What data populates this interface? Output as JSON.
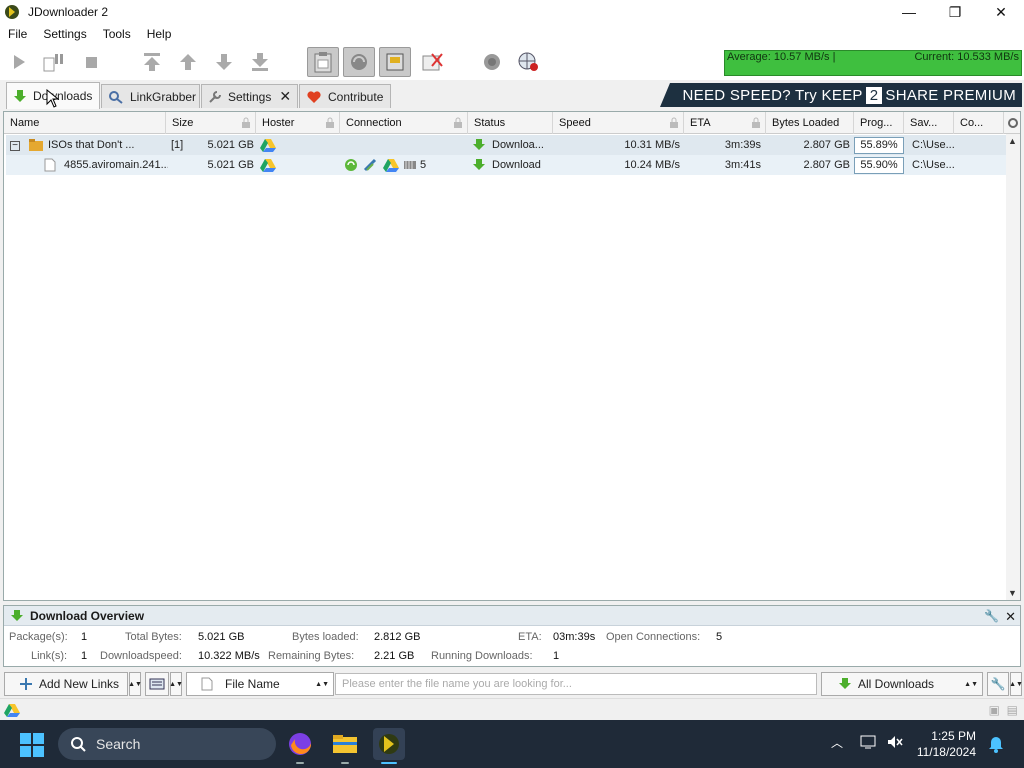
{
  "window": {
    "title": "JDownloader 2",
    "controls": [
      "minimize",
      "maximize",
      "close"
    ]
  },
  "menu": [
    "File",
    "Settings",
    "Tools",
    "Help"
  ],
  "speedmeter": {
    "average": "Average: 10.57 MB/s |",
    "current": "Current: 10.533 MB/s",
    "color": "#3fbf3f"
  },
  "tabs": [
    {
      "label": "Downloads",
      "icon": "download-arrow-icon",
      "active": true
    },
    {
      "label": "LinkGrabber",
      "icon": "linkgrabber-icon"
    },
    {
      "label": "Settings",
      "icon": "wrench-icon",
      "closable": true
    },
    {
      "label": "Contribute",
      "icon": "heart-icon"
    }
  ],
  "ad": {
    "part1": "NEED SPEED? Try KEEP",
    "num": "2",
    "part2": "SHARE PREMIUM"
  },
  "table": {
    "columns": [
      "Name",
      "Size",
      "Hoster",
      "Connection",
      "Status",
      "Speed",
      "ETA",
      "Bytes Loaded",
      "Prog...",
      "Sav...",
      "Co..."
    ],
    "rows": [
      {
        "type": "package",
        "expander": "−",
        "name": "ISOs that Don't ...",
        "count": "[1]",
        "size": "5.021 GB",
        "status": "Downloa...",
        "speed": "10.31 MB/s",
        "eta": "3m:39s",
        "bytes_loaded": "2.807 GB",
        "progress": "55.89%",
        "progress_fraction": 0.5589,
        "save_to": "C:\\Use..."
      },
      {
        "type": "link",
        "name": "4855.aviromain.241...",
        "size": "5.021 GB",
        "connections": "5",
        "status": "Download",
        "speed": "10.24 MB/s",
        "eta": "3m:41s",
        "bytes_loaded": "2.807 GB",
        "progress": "55.90%",
        "progress_fraction": 0.559,
        "save_to": "C:\\Use..."
      }
    ]
  },
  "overview": {
    "title": "Download Overview",
    "packages_label": "Package(s):",
    "packages": "1",
    "total_bytes_label": "Total Bytes:",
    "total_bytes": "5.021 GB",
    "bytes_loaded_label": "Bytes loaded:",
    "bytes_loaded": "2.812 GB",
    "eta_label": "ETA:",
    "eta": "03m:39s",
    "open_conn_label": "Open Connections:",
    "open_conn": "5",
    "links_label": "Link(s):",
    "links": "1",
    "dlspeed_label": "Downloadspeed:",
    "dlspeed": "10.322 MB/s",
    "remaining_label": "Remaining Bytes:",
    "remaining": "2.21 GB",
    "running_label": "Running Downloads:",
    "running": "1"
  },
  "bottom": {
    "add_links": "Add New Links",
    "filter_field": "File Name",
    "search_placeholder": "Please enter the file name you are looking for...",
    "view_select": "All Downloads"
  },
  "taskbar": {
    "search_label": "Search",
    "time": "1:25 PM",
    "date": "11/18/2024"
  }
}
